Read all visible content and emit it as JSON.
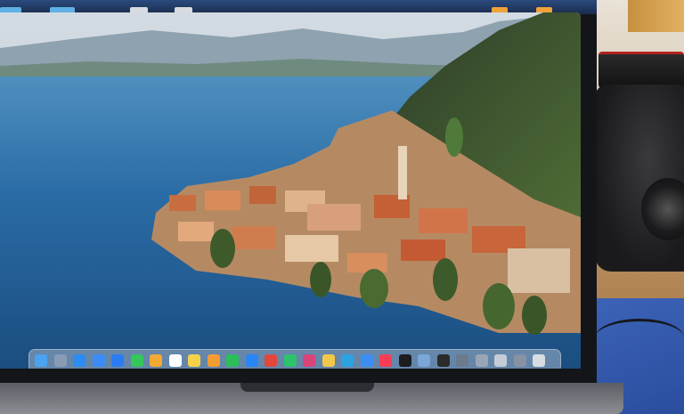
{
  "scene": {
    "description_visible_text": "",
    "colors": {
      "bezel": "#141518",
      "lake": "#2569a3",
      "sky": "#c9d3dc",
      "mountain": "#3c4a3a",
      "town_roofs": "#c86d3f",
      "desk_mat": "#3c63b8"
    }
  },
  "dock": {
    "icons": [
      {
        "name": "finder-icon",
        "color": "#4aa3f0"
      },
      {
        "name": "launchpad-icon",
        "color": "#8a9bb5"
      },
      {
        "name": "safari-icon",
        "color": "#2c8cf1"
      },
      {
        "name": "mail-icon",
        "color": "#3b8df5"
      },
      {
        "name": "app-store-icon",
        "color": "#2b7cf3"
      },
      {
        "name": "messages-icon",
        "color": "#34c759"
      },
      {
        "name": "photos-icon",
        "color": "#f4a934"
      },
      {
        "name": "calendar-icon",
        "color": "#ffffff"
      },
      {
        "name": "notes-icon",
        "color": "#f6d24b"
      },
      {
        "name": "pages-icon",
        "color": "#f39c32"
      },
      {
        "name": "numbers-icon",
        "color": "#2bbf5a"
      },
      {
        "name": "keynote-icon",
        "color": "#2a86f5"
      },
      {
        "name": "app-generic-icon",
        "color": "#e3463b"
      },
      {
        "name": "facetime-icon",
        "color": "#2fc36b"
      },
      {
        "name": "slack-icon",
        "color": "#d9447a"
      },
      {
        "name": "chrome-icon",
        "color": "#f2c84b"
      },
      {
        "name": "telegram-icon",
        "color": "#2ca3e0"
      },
      {
        "name": "xcode-icon",
        "color": "#3c8ef3"
      },
      {
        "name": "music-icon",
        "color": "#fa3d56"
      },
      {
        "name": "tv-icon",
        "color": "#1d1d1f"
      },
      {
        "name": "preview-icon",
        "color": "#7aa7d6"
      },
      {
        "name": "terminal-icon",
        "color": "#2b2b2b"
      },
      {
        "name": "window-thumb-icon",
        "color": "#6c7a8c"
      },
      {
        "name": "window-thumb-icon",
        "color": "#9aa6b5"
      },
      {
        "name": "window-thumb-icon",
        "color": "#c4ccd6"
      },
      {
        "name": "window-thumb-icon",
        "color": "#8793a3"
      },
      {
        "name": "trash-icon",
        "color": "#d8dde3"
      }
    ]
  }
}
